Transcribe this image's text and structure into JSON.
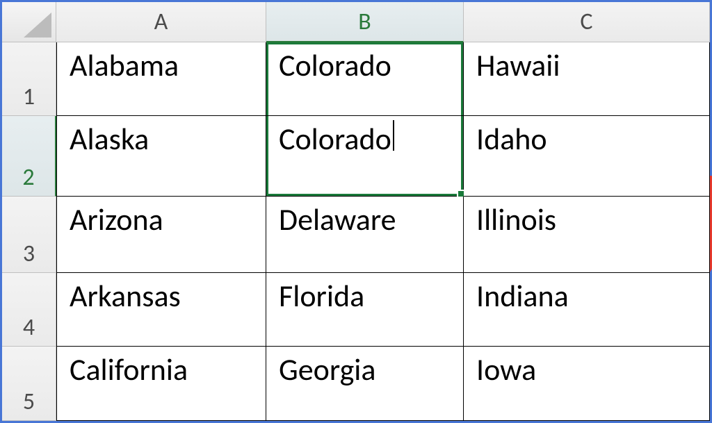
{
  "columns": [
    "A",
    "B",
    "C"
  ],
  "rows": [
    "1",
    "2",
    "3",
    "4",
    "5"
  ],
  "active_column": "B",
  "active_row": "2",
  "selected_range": "B1:B2",
  "editing_cell": "B2",
  "cells": {
    "r1": {
      "A": "Alabama",
      "B": "Colorado",
      "C": "Hawaii"
    },
    "r2": {
      "A": "Alaska",
      "B": "Colorado",
      "C": "Idaho"
    },
    "r3": {
      "A": "Arizona",
      "B": "Delaware",
      "C": "Illinois"
    },
    "r4": {
      "A": "Arkansas",
      "B": "Florida",
      "C": "Indiana"
    },
    "r5": {
      "A": "California",
      "B": "Georgia",
      "C": "Iowa"
    }
  },
  "annotation": {
    "type": "arrow-down",
    "color": "#e73b2f"
  }
}
